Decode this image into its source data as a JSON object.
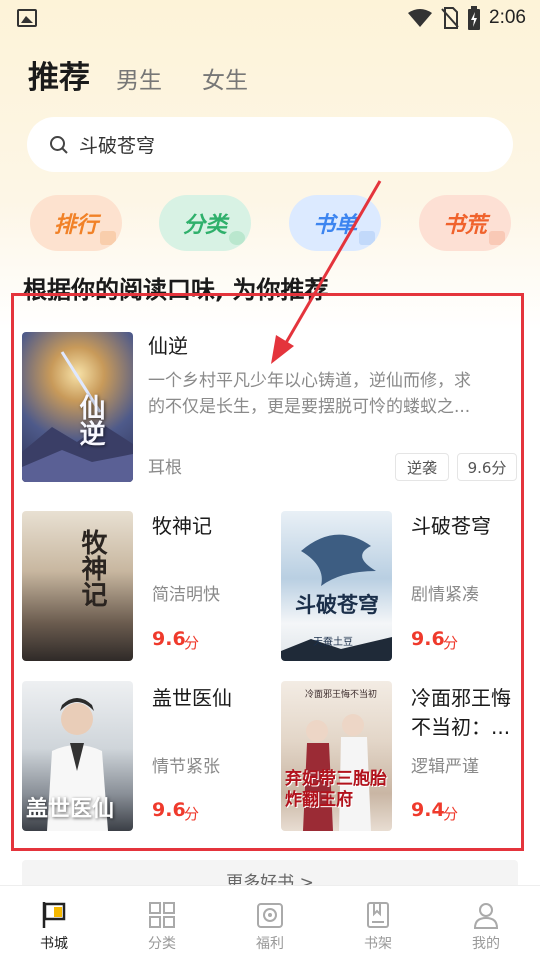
{
  "status_bar": {
    "time": "2:06"
  },
  "tabs": {
    "active": "推荐",
    "items": [
      "男生",
      "女生"
    ]
  },
  "search": {
    "value": "斗破苍穹"
  },
  "quick_buttons": [
    "排行",
    "分类",
    "书单",
    "书荒"
  ],
  "section_title": "根据你的阅读口味, 为你推荐",
  "featured": {
    "title": "仙逆",
    "cover_text": "仙逆",
    "desc_line1": "一个乡村平凡少年以心铸道，逆仙而修，求",
    "desc_line2": "的不仅是长生，更是要摆脱可怜的蝼蚁之...",
    "author": "耳根",
    "tag": "逆袭",
    "score": "9.6分"
  },
  "books": [
    {
      "title": "牧神记",
      "cover_text": "牧神记",
      "tag": "简洁明快",
      "score": "9.6",
      "unit": "分"
    },
    {
      "title": "斗破苍穹",
      "cover_text": "斗破苍穹",
      "cover_sub": "天蚕土豆",
      "tag": "剧情紧凑",
      "score": "9.6",
      "unit": "分"
    },
    {
      "title": "盖世医仙",
      "cover_text": "盖世医仙",
      "tag": "情节紧张",
      "score": "9.6",
      "unit": "分"
    },
    {
      "title_line1": "冷面邪王悔",
      "title_line2": "不当初：...",
      "cover_text": "弃妃带三胞胎炸翻王府",
      "cover_top": "冷面邪王悔不当初",
      "tag": "逻辑严谨",
      "score": "9.4",
      "unit": "分"
    }
  ],
  "more_label": "更多好书 >",
  "bottom_nav": [
    "书城",
    "分类",
    "福利",
    "书架",
    "我的"
  ],
  "colors": {
    "accent_red": "#ef3a2c",
    "annotation_red": "#e4343c"
  }
}
